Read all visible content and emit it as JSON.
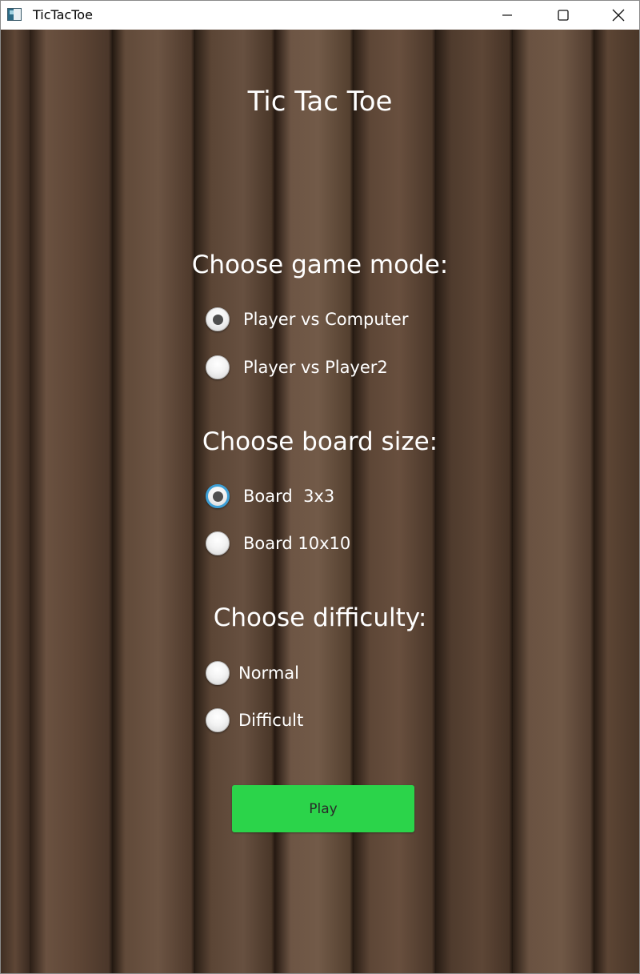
{
  "window": {
    "title": "TicTacToe"
  },
  "header": {
    "title": "Tic Tac Toe"
  },
  "game_mode": {
    "heading": "Choose game mode:",
    "options": [
      {
        "label": "Player vs Computer",
        "selected": true
      },
      {
        "label": "Player vs Player2",
        "selected": false
      }
    ]
  },
  "board_size": {
    "heading": "Choose board size:",
    "options": [
      {
        "label": "Board  3x3",
        "selected": true,
        "focused": true
      },
      {
        "label": "Board 10x10",
        "selected": false
      }
    ]
  },
  "difficulty": {
    "heading": "Choose difficulty:",
    "options": [
      {
        "label": "Normal",
        "selected": false
      },
      {
        "label": "Difficult",
        "selected": false
      }
    ]
  },
  "play_button": {
    "label": "Play"
  },
  "colors": {
    "play_button": "#2bd44a",
    "focus_ring": "#3d9fd6",
    "wood_base": "#5b4434",
    "text": "#ffffff"
  },
  "icons": {
    "app": "app-window-icon",
    "minimize": "minimize-icon",
    "maximize": "maximize-icon",
    "close": "close-icon"
  }
}
